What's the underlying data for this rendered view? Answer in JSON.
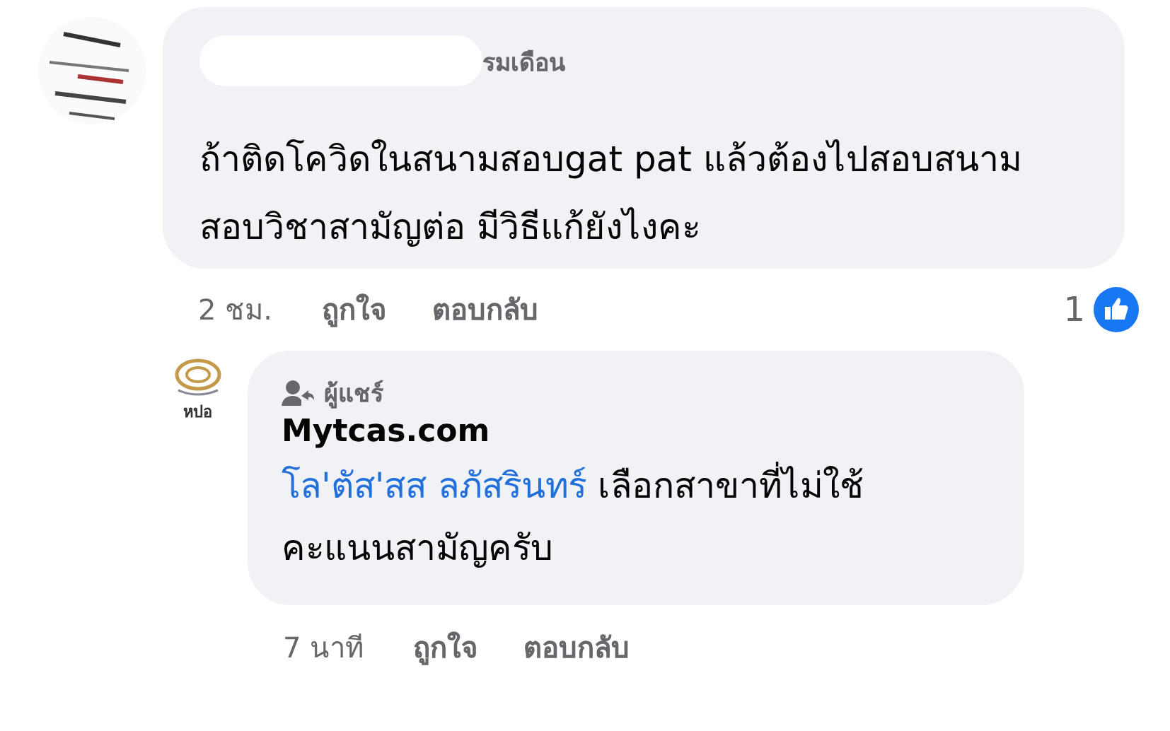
{
  "comment": {
    "author_fragment": "รมเดือน",
    "text": "ถ้าติดโควิดในสนามสอบgat pat แล้วต้องไปสอบสนามสอบวิชาสามัญต่อ มีวิธีแก้ยังไงคะ",
    "time": "2 ชม.",
    "actions": [
      "ถูกใจ",
      "ตอบกลับ"
    ],
    "reaction_count": "1"
  },
  "reply": {
    "logo_text": "หปอ",
    "badge": "ผู้แชร์",
    "author": "Mytcas.com",
    "mention": "โล'ตัส'สส ลภัสรินทร์",
    "text": "เลือกสาขาที่ไม่ใช้คะแนนสามัญครับ",
    "time": "7 นาที",
    "actions": [
      "ถูกใจ",
      "ตอบกลับ"
    ]
  }
}
